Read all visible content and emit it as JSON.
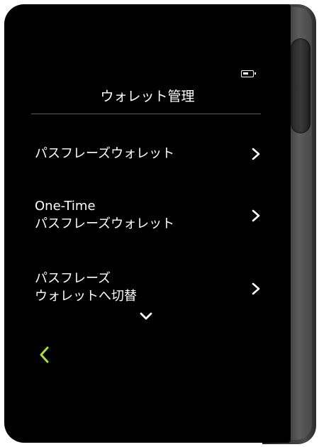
{
  "device": {
    "battery_icon": "battery-low-icon"
  },
  "header": {
    "title": "ウォレット管理"
  },
  "menu": {
    "items": [
      {
        "lines": [
          "パスフレーズウォレット"
        ],
        "icon": "chevron-right-icon"
      },
      {
        "lines": [
          "One-Time",
          "パスフレーズウォレット"
        ],
        "icon": "chevron-right-icon"
      },
      {
        "lines": [
          "パスフレーズ",
          "ウォレットへ切替"
        ],
        "icon": "chevron-right-icon"
      }
    ]
  },
  "navigation": {
    "scroll_indicator_icon": "chevron-down-icon",
    "back_icon": "chevron-left-icon"
  },
  "colors": {
    "screen_background": "#000000",
    "text": "#ffffff",
    "divider": "#5a5a5a",
    "accent_back": "#a6e22e",
    "device_frame": "#3c3c3c"
  }
}
